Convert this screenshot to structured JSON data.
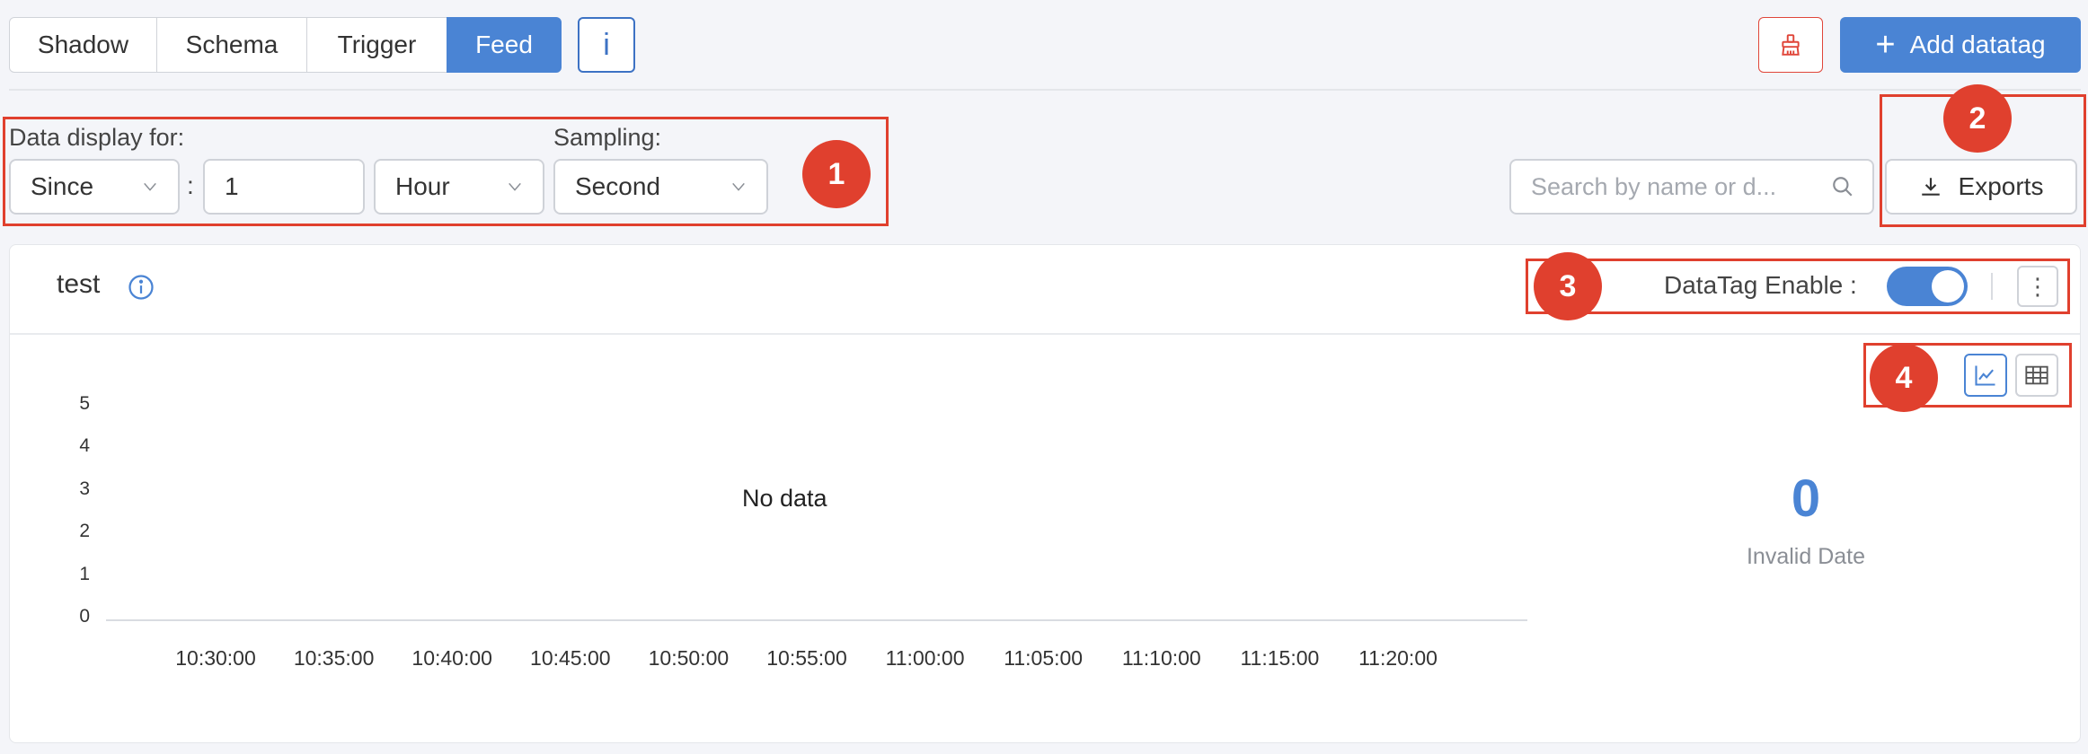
{
  "tabs": [
    {
      "label": "Shadow",
      "active": false
    },
    {
      "label": "Schema",
      "active": false
    },
    {
      "label": "Trigger",
      "active": false
    },
    {
      "label": "Feed",
      "active": true
    }
  ],
  "info_button": "i",
  "add_button": {
    "label": "Add datatag",
    "icon": "plus-icon"
  },
  "clear_button": {
    "icon": "broom-icon"
  },
  "controls": {
    "data_display_label": "Data display for:",
    "range_mode": "Since",
    "colon": ":",
    "range_value": "1",
    "range_unit": "Hour",
    "sampling_label": "Sampling:",
    "sampling_value": "Second"
  },
  "search": {
    "placeholder": "Search by name or d..."
  },
  "exports": {
    "label": "Exports"
  },
  "card": {
    "title": "test",
    "datatag_enable_label": "DataTag Enable :",
    "datatag_enabled": true
  },
  "chart_data": {
    "type": "line",
    "series": [],
    "empty_text": "No data",
    "yticks": [
      "5",
      "4",
      "3",
      "2",
      "1",
      "0"
    ],
    "xticks": [
      "10:30:00",
      "10:35:00",
      "10:40:00",
      "10:45:00",
      "10:50:00",
      "10:55:00",
      "11:00:00",
      "11:05:00",
      "11:10:00",
      "11:15:00",
      "11:20:00"
    ],
    "ylim": [
      0,
      5
    ]
  },
  "stat": {
    "value": "0",
    "subtitle": "Invalid Date"
  },
  "annotations": [
    "1",
    "2",
    "3",
    "4"
  ],
  "colors": {
    "accent": "#4a84d4",
    "annotation": "#e0402e"
  }
}
